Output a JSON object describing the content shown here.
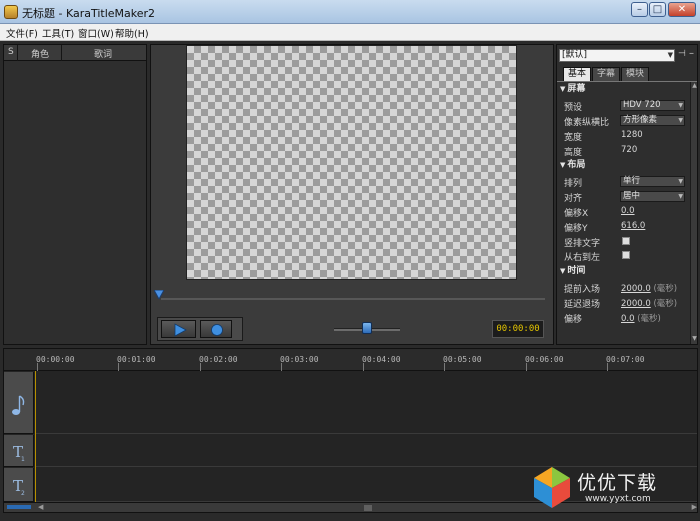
{
  "window": {
    "title": "无标题 - KaraTitleMaker2",
    "minimize": "–",
    "maximize": "□",
    "close": "✕"
  },
  "menu": [
    "文件(F)",
    "工具(T)",
    "窗口(W)",
    "帮助(H)"
  ],
  "lyrics_panel": {
    "col_s": "S",
    "col_role": "角色",
    "col_lyrics": "歌词"
  },
  "preview": {
    "time": "00:00:00"
  },
  "properties": {
    "preset": "[默认]",
    "tabs": [
      "基本",
      "字幕",
      "模块"
    ],
    "sections": {
      "screen": {
        "title": "屏幕",
        "preset_label": "预设",
        "preset_value": "HDV 720",
        "aspect_label": "像素纵横比",
        "aspect_value": "方形像素",
        "width_label": "宽度",
        "width_value": "1280",
        "height_label": "高度",
        "height_value": "720"
      },
      "layout": {
        "title": "布局",
        "arrange_label": "排列",
        "arrange_value": "单行",
        "align_label": "对齐",
        "align_value": "居中",
        "offset_x_label": "偏移X",
        "offset_x_value": "0.0",
        "offset_y_label": "偏移Y",
        "offset_y_value": "616.0",
        "vertical_label": "竖排文字",
        "rtl_label": "从右到左"
      },
      "time": {
        "title": "时间",
        "advance_in_label": "提前入场",
        "advance_in_value": "2000.0",
        "advance_in_unit": "(毫秒)",
        "delay_out_label": "延迟退场",
        "delay_out_value": "2000.0",
        "delay_out_unit": "(毫秒)",
        "offset_label": "偏移",
        "offset_value": "0.0",
        "offset_unit": "(毫秒)"
      }
    }
  },
  "timeline": {
    "ticks": [
      "00:00:00",
      "00:01:00",
      "00:02:00",
      "00:03:00",
      "00:04:00",
      "00:05:00",
      "00:06:00",
      "00:07:00"
    ],
    "tracks": [
      "music-note",
      "T",
      "T"
    ]
  },
  "watermark": {
    "text": "优优下载",
    "url": "www.yyxt.com"
  }
}
